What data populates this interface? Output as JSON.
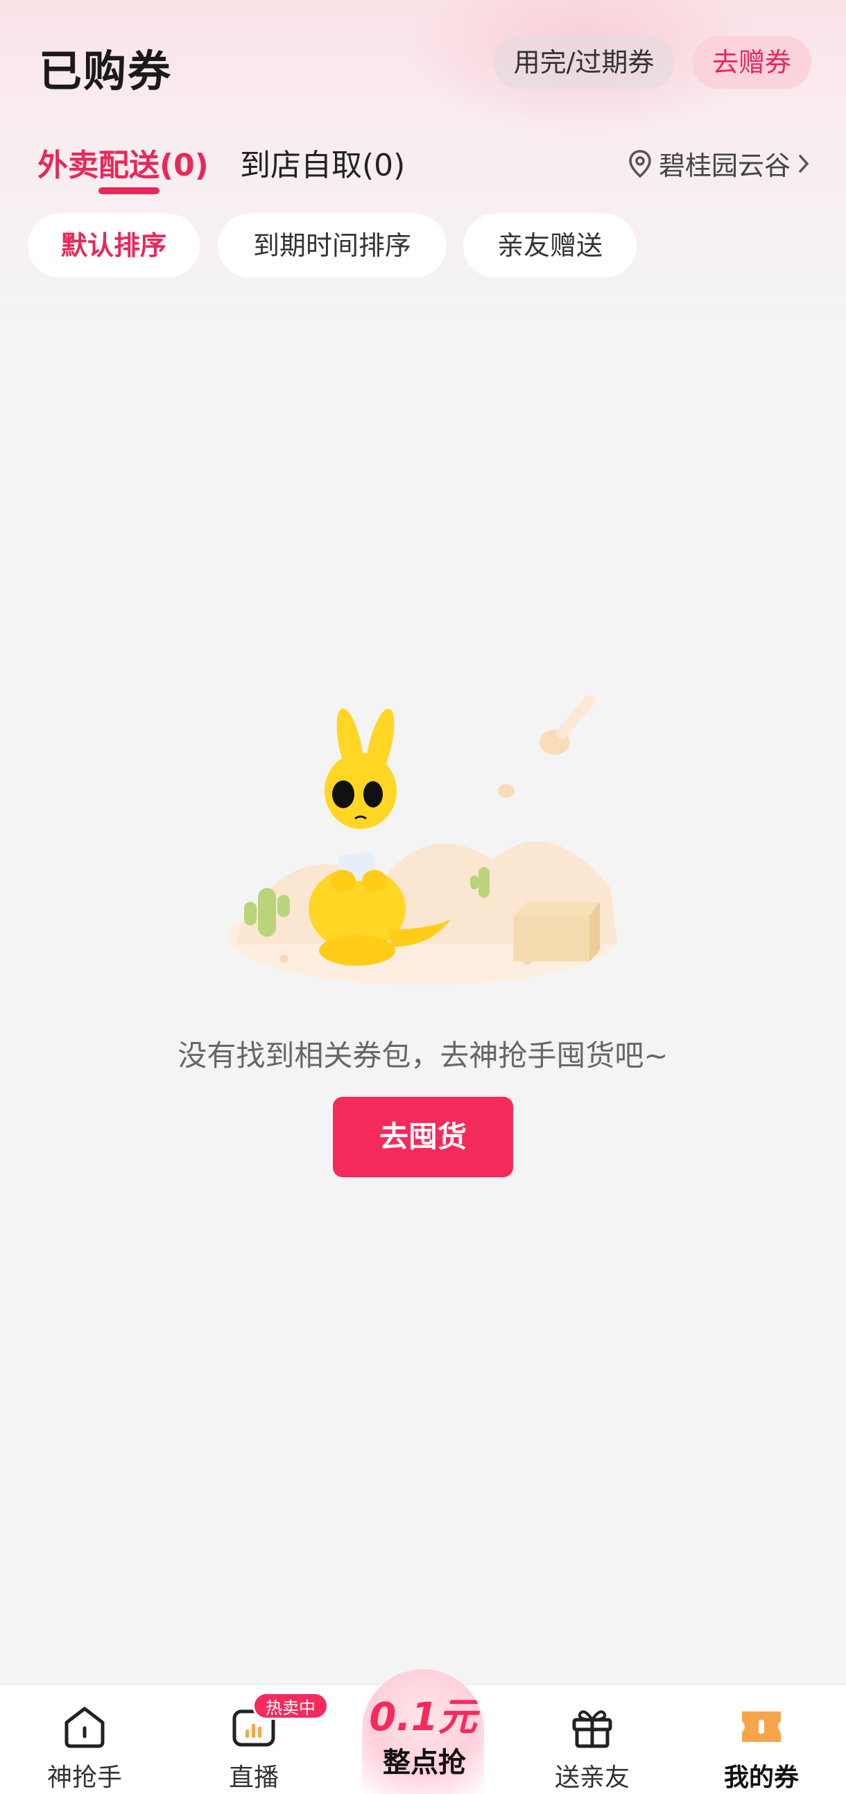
{
  "header": {
    "title": "已购券",
    "expired_button": "用完/过期券",
    "gift_button": "去赠券"
  },
  "tabs": {
    "delivery": "外卖配送(0)",
    "pickup": "到店自取(0)",
    "active": "delivery"
  },
  "location": {
    "name": "碧桂园云谷",
    "icon": "location-pin-icon"
  },
  "filters": [
    "默认排序",
    "到期时间排序",
    "亲友赠送"
  ],
  "empty_state": {
    "message": "没有找到相关券包，去神抢手囤货吧~",
    "button": "去囤货"
  },
  "bottom_nav": {
    "items": [
      {
        "label": "神抢手",
        "icon": "home-icon"
      },
      {
        "label": "直播",
        "icon": "live-tv-icon",
        "badge": "热卖中"
      },
      {
        "label": "送亲友",
        "icon": "gift-icon"
      },
      {
        "label": "我的券",
        "icon": "coupon-icon"
      }
    ],
    "center_promo": {
      "price": "0.1元",
      "subtitle": "整点抢"
    }
  },
  "colors": {
    "accent": "#e8285a",
    "button": "#f52a5c",
    "background": "#f4f4f4",
    "coupon_icon": "#f7a54a"
  }
}
